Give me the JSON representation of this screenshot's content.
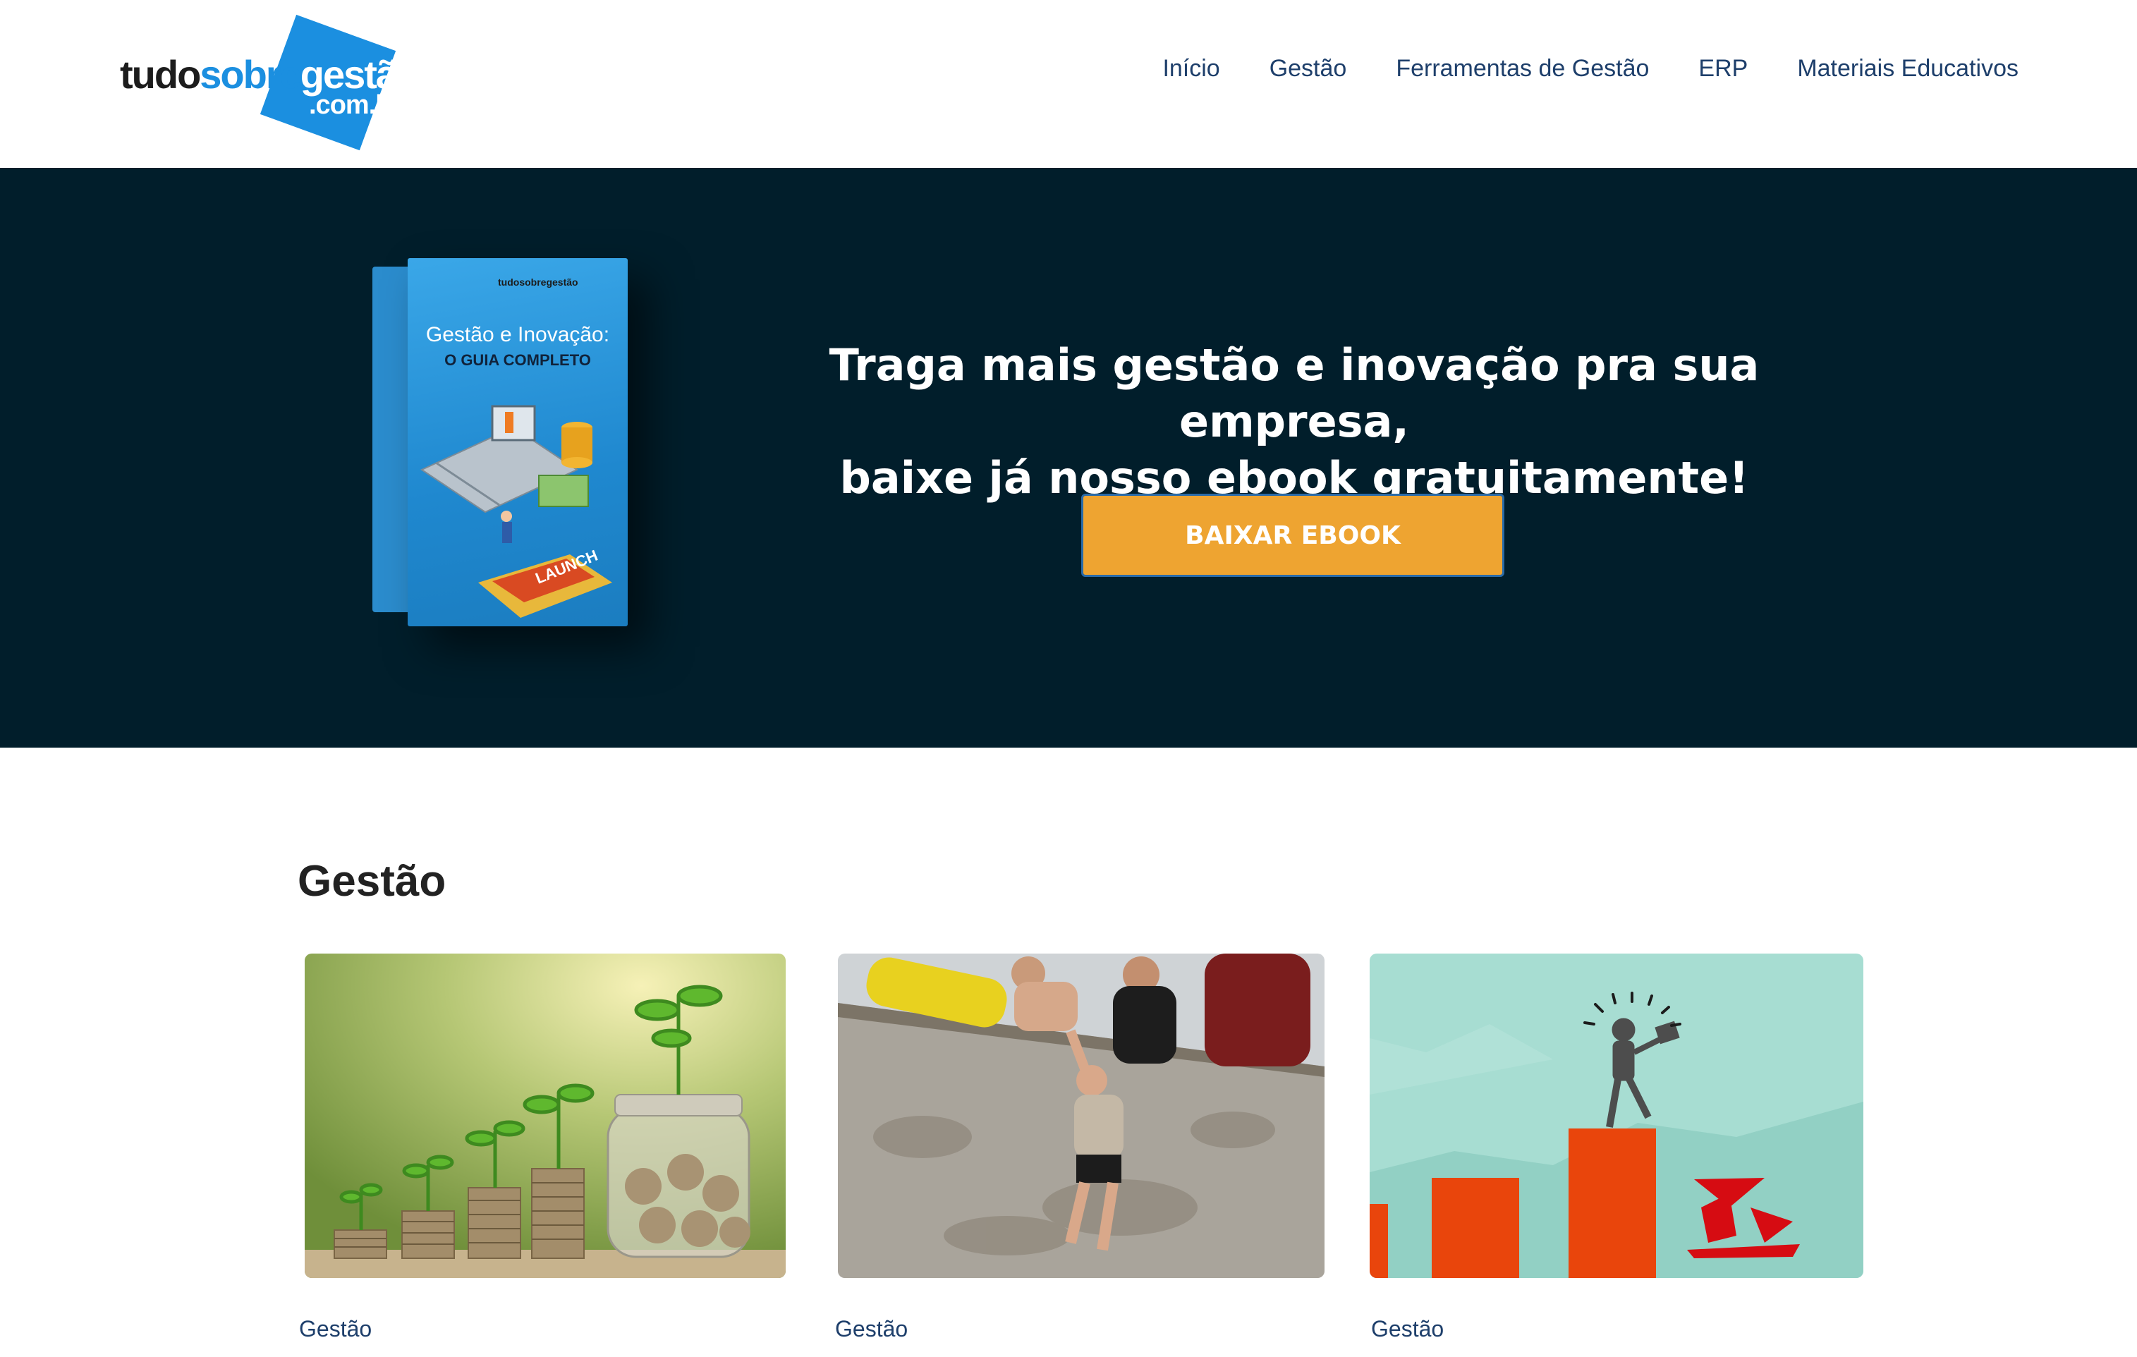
{
  "header": {
    "logo": {
      "part1": "tudo",
      "part2": "sobre",
      "part3": "gestão",
      "sub": ".com.br",
      "brand_color": "#1b8fe0"
    },
    "nav": [
      "Início",
      "Gestão",
      "Ferramentas de Gestão",
      "ERP",
      "Materiais Educativos"
    ]
  },
  "hero": {
    "background": "#011e2b",
    "book": {
      "brand": "tudosobregestão",
      "title": "Gestão e Inovação:",
      "subtitle": "O GUIA COMPLETO",
      "button_text": "LAUNCH"
    },
    "heading_line1": "Traga mais gestão e inovação pra sua empresa,",
    "heading_line2": "baixe já nosso ebook gratuitamente!",
    "cta_label": "BAIXAR EBOOK",
    "cta_color": "#eea431"
  },
  "section": {
    "title": "Gestão",
    "cards": [
      {
        "category": "Gestão",
        "image": "coins-and-plants-image"
      },
      {
        "category": "Gestão",
        "image": "people-climbing-wall-image"
      },
      {
        "category": "Gestão",
        "image": "bar-chart-illustration-image"
      }
    ]
  }
}
